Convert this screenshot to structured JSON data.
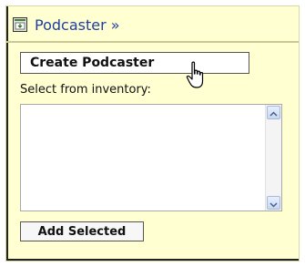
{
  "header": {
    "icon": "window-podcast-icon",
    "title": "Podcaster »",
    "link_color": "#1f3f9e"
  },
  "actions": {
    "create_label": "Create Podcaster",
    "add_label": "Add Selected"
  },
  "inventory": {
    "label": "Select from inventory:",
    "items": []
  },
  "theme": {
    "panel_bg": "#ffffd2"
  },
  "cursor": {
    "icon": "hand-pointer-icon"
  }
}
